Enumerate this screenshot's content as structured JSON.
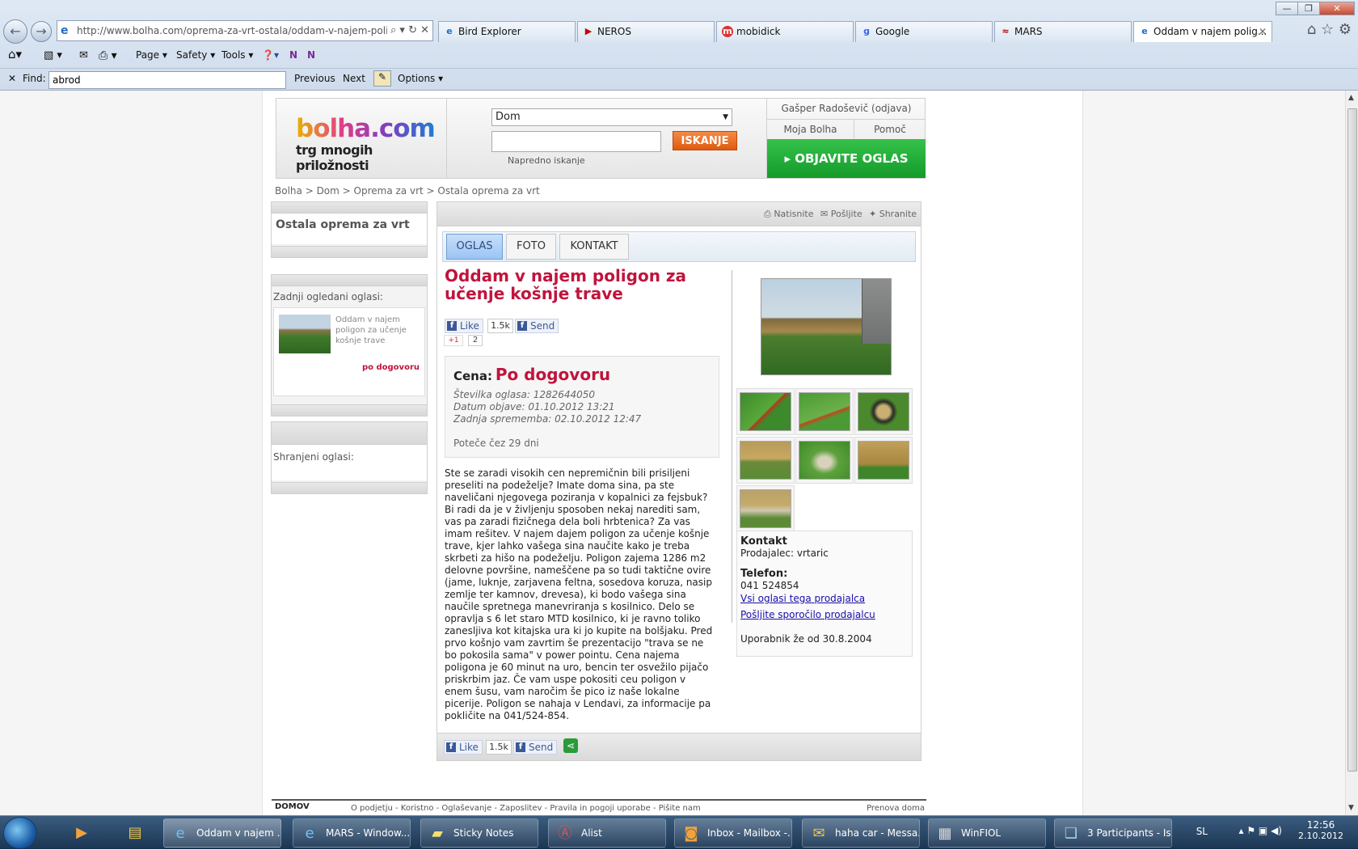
{
  "browser": {
    "address": "http://www.bolha.com/oprema-za-vrt-ostala/oddam-v-najem-poligo",
    "tabs": [
      "Bird Explorer",
      "NEROS",
      "mobidick",
      "Google",
      "MARS",
      "Oddam v najem polig..."
    ],
    "commands": {
      "page": "Page",
      "safety": "Safety",
      "tools": "Tools"
    },
    "find": {
      "label": "Find:",
      "value": "abrod",
      "previous": "Previous",
      "next": "Next",
      "options": "Options"
    }
  },
  "header": {
    "logo_top": "bolha.com",
    "logo_bottom": "trg mnogih priložnosti",
    "category": "Dom",
    "search_button": "ISKANJE",
    "advanced": "Napredno iskanje",
    "user": "Gašper Radoševič (odjava)",
    "moja": "Moja Bolha",
    "pomoc": "Pomoč",
    "post": "OBJAVITE OGLAS"
  },
  "breadcrumb": [
    "Bolha",
    "Dom",
    "Oprema za vrt",
    "Ostala oprema za vrt"
  ],
  "sidebar": {
    "category_title": "Ostala oprema za vrt",
    "recent_title": "Zadnji ogledani oglasi:",
    "recent_item": "Oddam v najem poligon za učenje košnje trave",
    "recent_price": "po dogovoru",
    "saved_title": "Shranjeni oglasi:"
  },
  "actions": {
    "print": "Natisnite",
    "send": "Pošljite",
    "save": "Shranite"
  },
  "tabs": {
    "ad": "OGLAS",
    "photo": "FOTO",
    "contact": "KONTAKT"
  },
  "ad": {
    "title": "Oddam v najem poligon za učenje košnje trave",
    "like": "Like",
    "like_count": "1.5k",
    "send": "Send",
    "gplus": "+1",
    "gplus_count": "2",
    "price_label": "Cena:",
    "price": "Po dogovoru",
    "number": "Številka oglasa: 1282644050",
    "published": "Datum objave: 01.10.2012 13:21",
    "modified": "Zadnja sprememba: 02.10.2012 12:47",
    "expires": "Poteče čez 29 dni",
    "description": "Ste se zaradi visokih cen nepremičnin bili prisiljeni preseliti na podeželje? Imate doma sina, pa ste naveličani njegovega poziranja v kopalnici za fejsbuk? Bi radi da je v življenju sposoben nekaj narediti sam, vas pa zaradi fizičnega dela boli hrbtenica? Za vas imam rešitev. V najem dajem poligon za učenje košnje trave, kjer lahko vašega sina naučite kako je treba skrbeti za hišo na podeželju. Poligon zajema 1286 m2 delovne površine, nameščene pa so tudi taktične ovire (jame, luknje, zarjavena feltna, sosedova koruza, nasip zemlje ter kamnov, drevesa), ki bodo vašega sina naučile spretnega manevriranja s kosilnico. Delo se opravlja s 6 let staro MTD kosilnico, ki je ravno toliko zanesljiva kot kitajska ura ki jo kupite na bolšjaku. Pred prvo košnjo vam zavrtim še prezentacijo \"trava se ne bo pokosila sama\" v power pointu. Cena najema poligona je 60 minut na uro, bencin ter osvežilo pijačo priskrbim jaz. Če vam uspe pokositi ceu poligon v enem šusu, vam naročim še pico iz naše lokalne picerije. Poligon se nahaja v Lendavi, za informacije pa pokličite na 041/524-854."
  },
  "contact": {
    "title": "Kontakt",
    "seller": "Prodajalec: vrtaric",
    "phone_label": "Telefon:",
    "phone": "041 524854",
    "all_ads": "Vsi oglasi tega prodajalca",
    "message": "Pošljite sporočilo prodajalcu",
    "member_since": "Uporabnik že od 30.8.2004"
  },
  "footer": {
    "home": "DOMOV",
    "links": "O podjetju - Koristno - Oglaševanje - Zaposlitev - Pravila in pogoji uporabe - Pišite nam",
    "right": "Prenova doma"
  },
  "taskbar": {
    "items": [
      "Oddam v najem ...",
      "MARS - Window...",
      "Sticky Notes",
      "Alist",
      "Inbox - Mailbox -...",
      "haha car - Messa...",
      "WinFIOL",
      "3 Participants - Is..."
    ],
    "lang": "SL",
    "time": "12:56",
    "date": "2.10.2012"
  },
  "colors": {
    "brand_red": "#c0143c",
    "post_green": "#1fa834",
    "search_orange": "#e8681e"
  }
}
